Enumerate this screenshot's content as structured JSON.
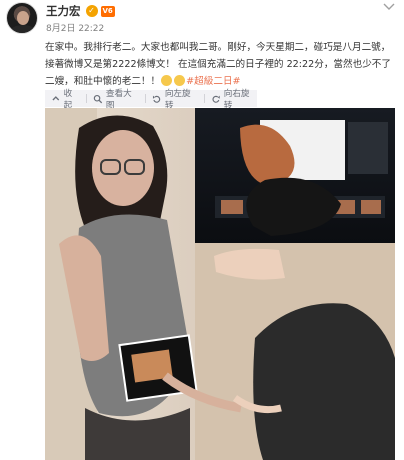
{
  "post": {
    "author": "王力宏",
    "verify_badge": "✓",
    "vip_badge": "V6",
    "date": "8月2日 22:22",
    "text_main": "在家中。我排行老二。大家也都叫我二哥。剛好，今天星期二，碰巧是八月二號，接著微博又是第2222條博文！ 在這個充滿二的日子裡的 22:22分，當然也少不了二嫂，和肚中懷的老二！！",
    "hashtag": "#超級二日#",
    "emoji_count": 2
  },
  "toolbar": {
    "collect": "收起",
    "view_large": "查看大图",
    "rotate_left": "向左旋转",
    "rotate_right": "向右旋转"
  },
  "colors": {
    "link": "#eb7350",
    "toolbar_bg": "#f2f2f5",
    "toolbar_text": "#696e78"
  },
  "icons": [
    "more-icon",
    "collapse-icon",
    "zoom-icon",
    "rotate-left-icon",
    "rotate-right-icon"
  ]
}
